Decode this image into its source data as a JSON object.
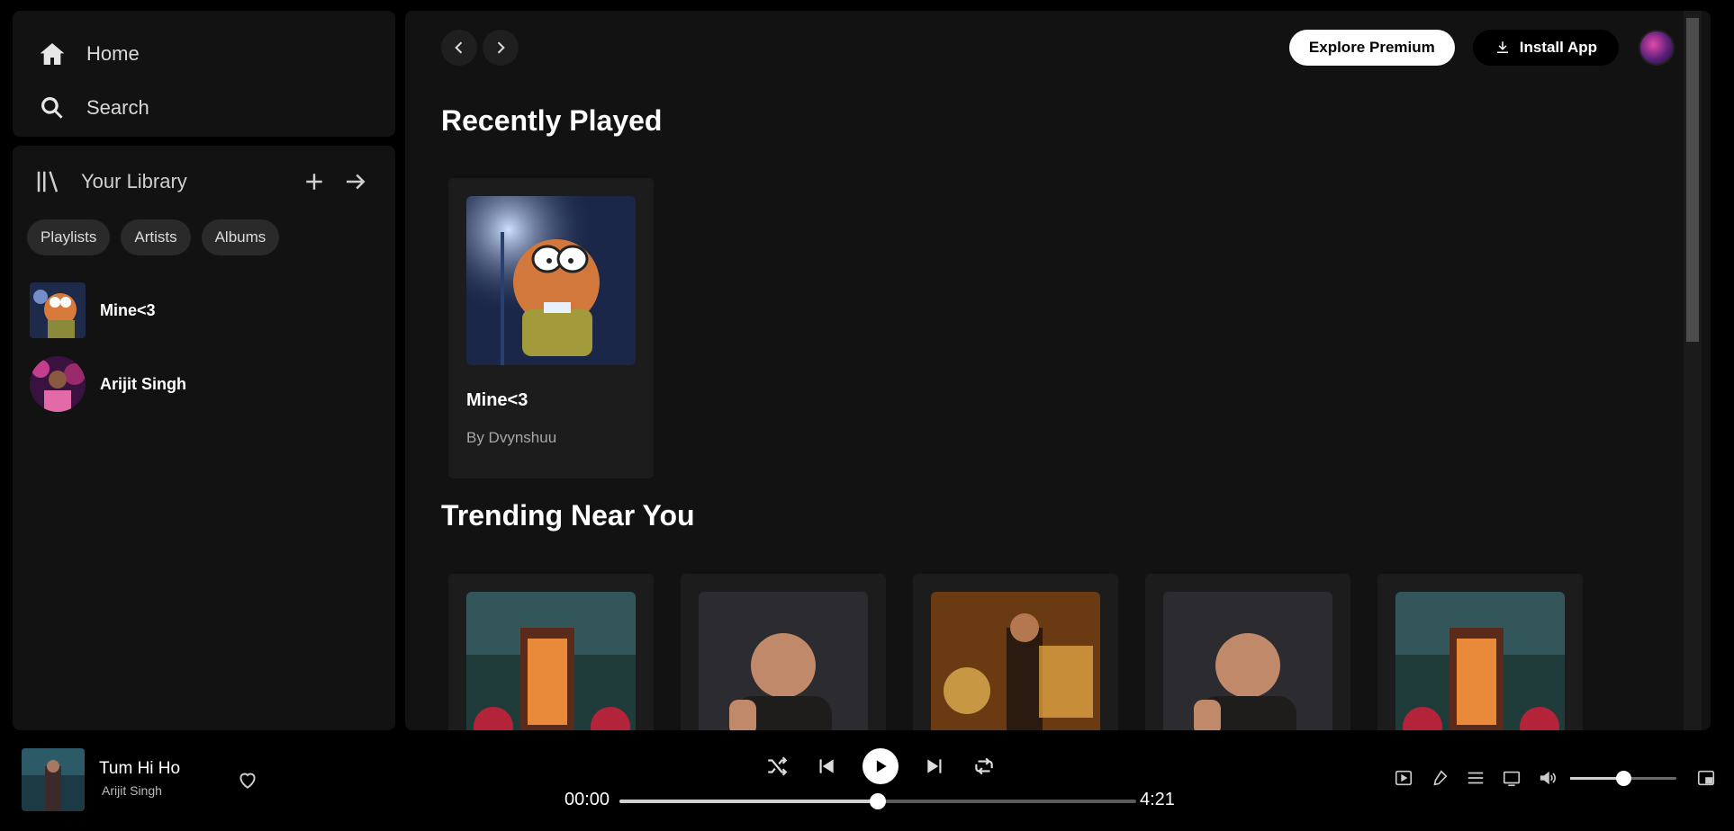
{
  "nav": {
    "home_label": "Home",
    "search_label": "Search"
  },
  "library": {
    "title": "Your Library",
    "chips": [
      "Playlists",
      "Artists",
      "Albums"
    ],
    "items": [
      {
        "name": "Mine<3"
      },
      {
        "name": "Arijit Singh"
      }
    ]
  },
  "topbar": {
    "premium_label": "Explore Premium",
    "install_label": "Install App"
  },
  "recently_played": {
    "title": "Recently Played",
    "cards": [
      {
        "title": "Mine<3",
        "subtitle": "By Dvynshuu"
      }
    ]
  },
  "trending": {
    "title": "Trending Near You"
  },
  "player": {
    "track_title": "Tum Hi Ho",
    "track_artist": "Arijit Singh",
    "current_time": "00:00",
    "total_time": "4:21",
    "progress": 0.5,
    "volume": 0.5
  },
  "colors": {
    "background": "#000000",
    "panel": "#121212",
    "card": "#1c1c1c",
    "text_secondary": "#a7a7a7"
  }
}
